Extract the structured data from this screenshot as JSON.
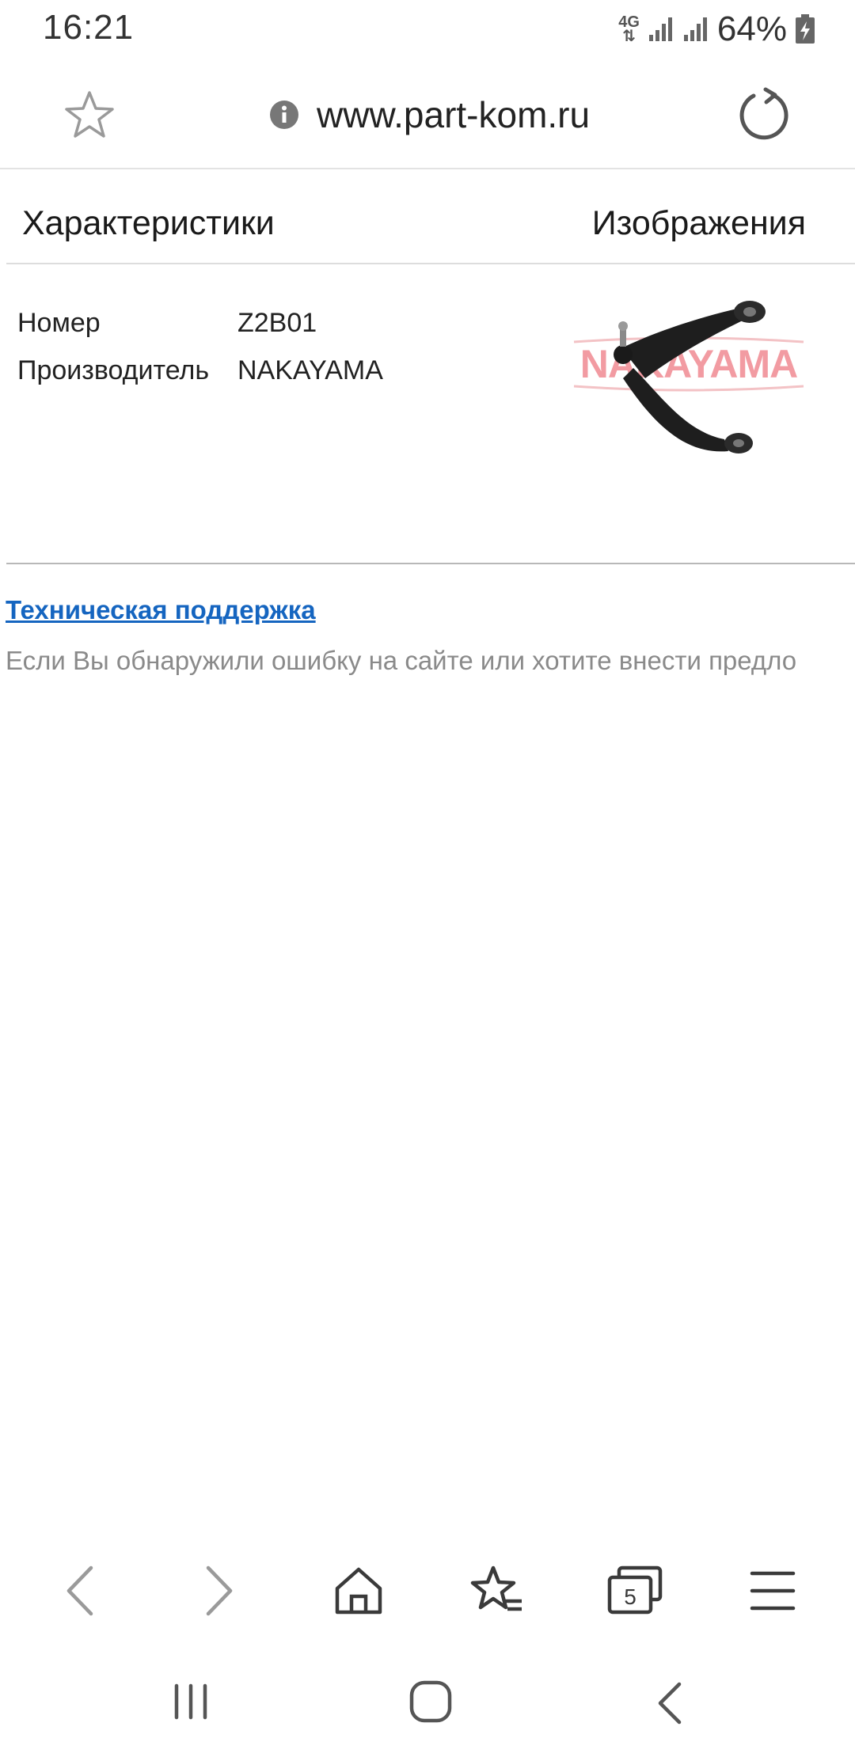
{
  "status_bar": {
    "time": "16:21",
    "network": "4G",
    "battery": "64%"
  },
  "url_bar": {
    "url": "www.part-kom.ru",
    "icons": [
      "star-icon",
      "info-icon",
      "reload-icon"
    ]
  },
  "tabs": {
    "characteristics": "Характеристики",
    "images": "Изображения"
  },
  "specs": [
    {
      "label": "Номер",
      "value": "Z2B01"
    },
    {
      "label": "Производитель",
      "value": "NAKAYAMA"
    }
  ],
  "product_image": {
    "logo_text": "NAKAYAMA",
    "logo_color": "#e53945"
  },
  "support": {
    "link": "Техническая поддержка",
    "text": "Если Вы обнаружили ошибку на сайте или хотите внести предло"
  },
  "browser_nav": {
    "tab_count": "5",
    "icons": [
      "back-icon",
      "forward-icon",
      "home-icon",
      "bookmarks-icon",
      "tabs-icon",
      "menu-icon"
    ]
  },
  "system_nav": {
    "icons": [
      "recents-icon",
      "home-circle-icon",
      "system-back-icon"
    ]
  },
  "colors": {
    "link": "#1565c0",
    "muted_text": "#8a8a8a",
    "divider": "#b8b8b8"
  }
}
